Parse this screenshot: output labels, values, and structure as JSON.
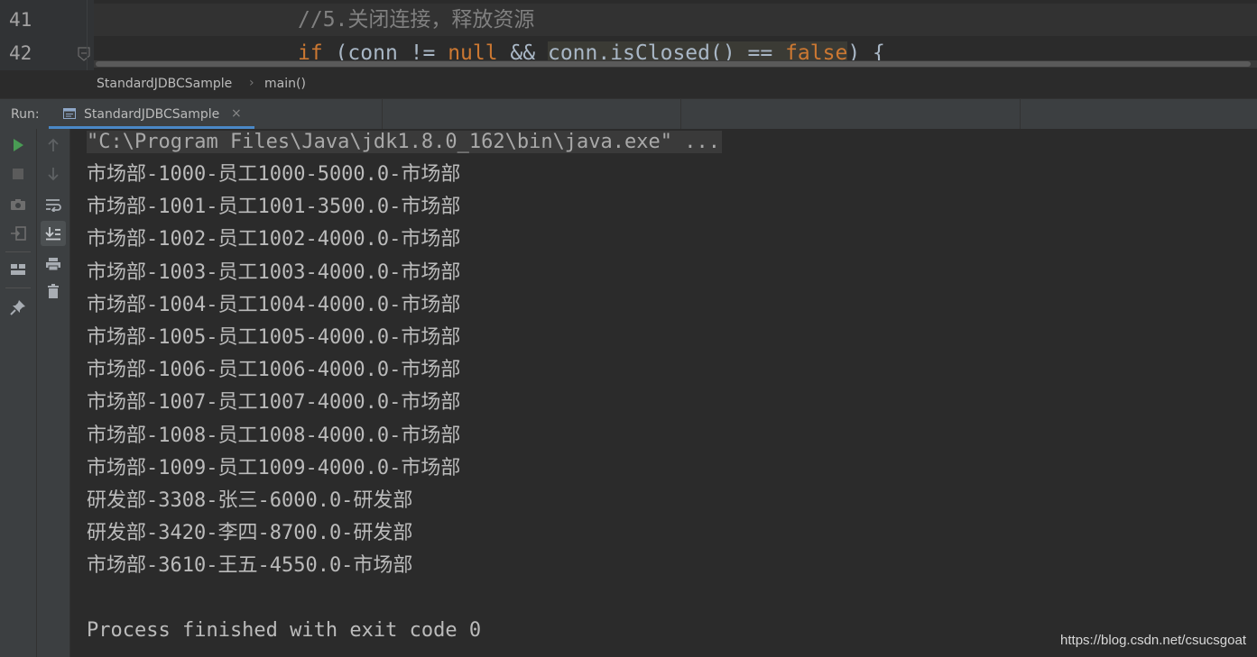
{
  "editor": {
    "lines": [
      {
        "number": "41",
        "comment": "//5.关闭连接，释放资源"
      },
      {
        "number": "42",
        "kw_if": "if",
        "paren_open": " (",
        "var1": "conn",
        "op_ne": " != ",
        "kw_null": "null",
        "op_and": " && ",
        "var2": "conn",
        "method": ".isClosed() == ",
        "kw_false": "false",
        "tail": ") {"
      }
    ]
  },
  "breadcrumb": {
    "items": [
      "StandardJDBCSample",
      "main()"
    ],
    "separator": "›"
  },
  "run": {
    "label": "Run:",
    "tab_label": "StandardJDBCSample",
    "tab_close": "×"
  },
  "console": {
    "command": "\"C:\\Program Files\\Java\\jdk1.8.0_162\\bin\\java.exe\" ...",
    "lines": [
      "市场部-1000-员工1000-5000.0-市场部",
      "市场部-1001-员工1001-3500.0-市场部",
      "市场部-1002-员工1002-4000.0-市场部",
      "市场部-1003-员工1003-4000.0-市场部",
      "市场部-1004-员工1004-4000.0-市场部",
      "市场部-1005-员工1005-4000.0-市场部",
      "市场部-1006-员工1006-4000.0-市场部",
      "市场部-1007-员工1007-4000.0-市场部",
      "市场部-1008-员工1008-4000.0-市场部",
      "市场部-1009-员工1009-4000.0-市场部",
      "研发部-3308-张三-6000.0-研发部",
      "研发部-3420-李四-8700.0-研发部",
      "市场部-3610-王五-4550.0-市场部"
    ],
    "exit_message": "Process finished with exit code 0"
  },
  "watermark": "https://blog.csdn.net/csucsgoat",
  "colors": {
    "accent": "#4a88c7",
    "run_green": "#499c54",
    "keyword": "#cc7832",
    "comment": "#808080"
  },
  "icons": {
    "toolbar_1": [
      "run-icon",
      "stop-icon",
      "camera-icon",
      "login-icon",
      "layout-icon",
      "pin-icon"
    ],
    "toolbar_2": [
      "arrow-up-icon",
      "arrow-down-icon",
      "soft-wrap-icon",
      "scroll-to-end-icon",
      "print-icon",
      "trash-icon"
    ]
  }
}
